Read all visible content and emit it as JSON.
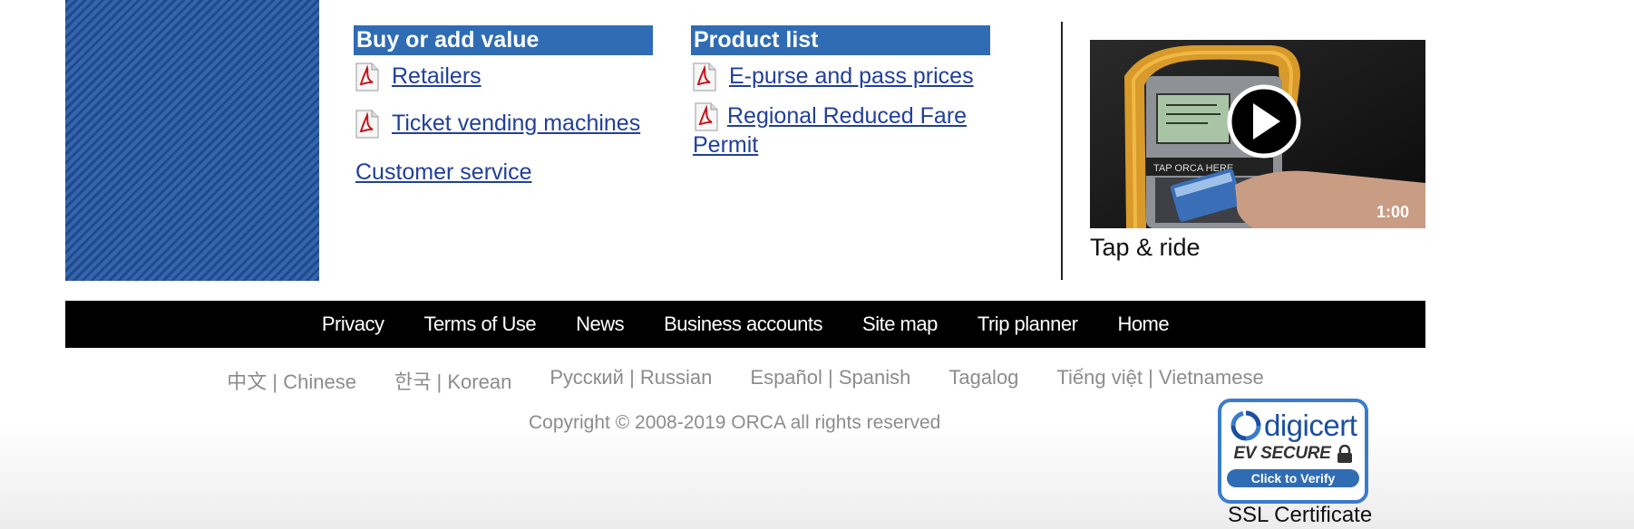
{
  "buy": {
    "header": "Buy or add value",
    "retailers": "Retailers",
    "ticket_vending": "Ticket vending machines",
    "customer_service": "Customer service"
  },
  "product": {
    "header": "Product list",
    "epurse": "E-purse and pass prices",
    "regional": "Regional Reduced Fare Permit"
  },
  "video": {
    "screen_text": "TAP ORCA HERE",
    "duration": "1:00",
    "caption": "Tap & ride"
  },
  "footer_nav": [
    "Privacy",
    "Terms of Use",
    "News",
    "Business accounts",
    "Site map",
    "Trip planner",
    "Home"
  ],
  "languages": [
    "中文 | Chinese",
    "한국 | Korean",
    "Русский | Russian",
    "Español | Spanish",
    "Tagalog",
    "Tiếng việt | Vietnamese"
  ],
  "copyright": "Copyright © 2008-2019 ORCA all rights reserved",
  "digicert": {
    "brand": "digicert",
    "ev_secure": "EV SECURE",
    "verify": "Click to Verify",
    "label": "SSL Certificate"
  },
  "icons": {
    "pdf": "pdf-icon",
    "play": "play-icon",
    "lock": "lock-icon"
  },
  "colors": {
    "header_blue": "#2f6cb4",
    "link_blue": "#22409a",
    "footer_black": "#000000",
    "lang_gray": "#8c8c8c"
  }
}
